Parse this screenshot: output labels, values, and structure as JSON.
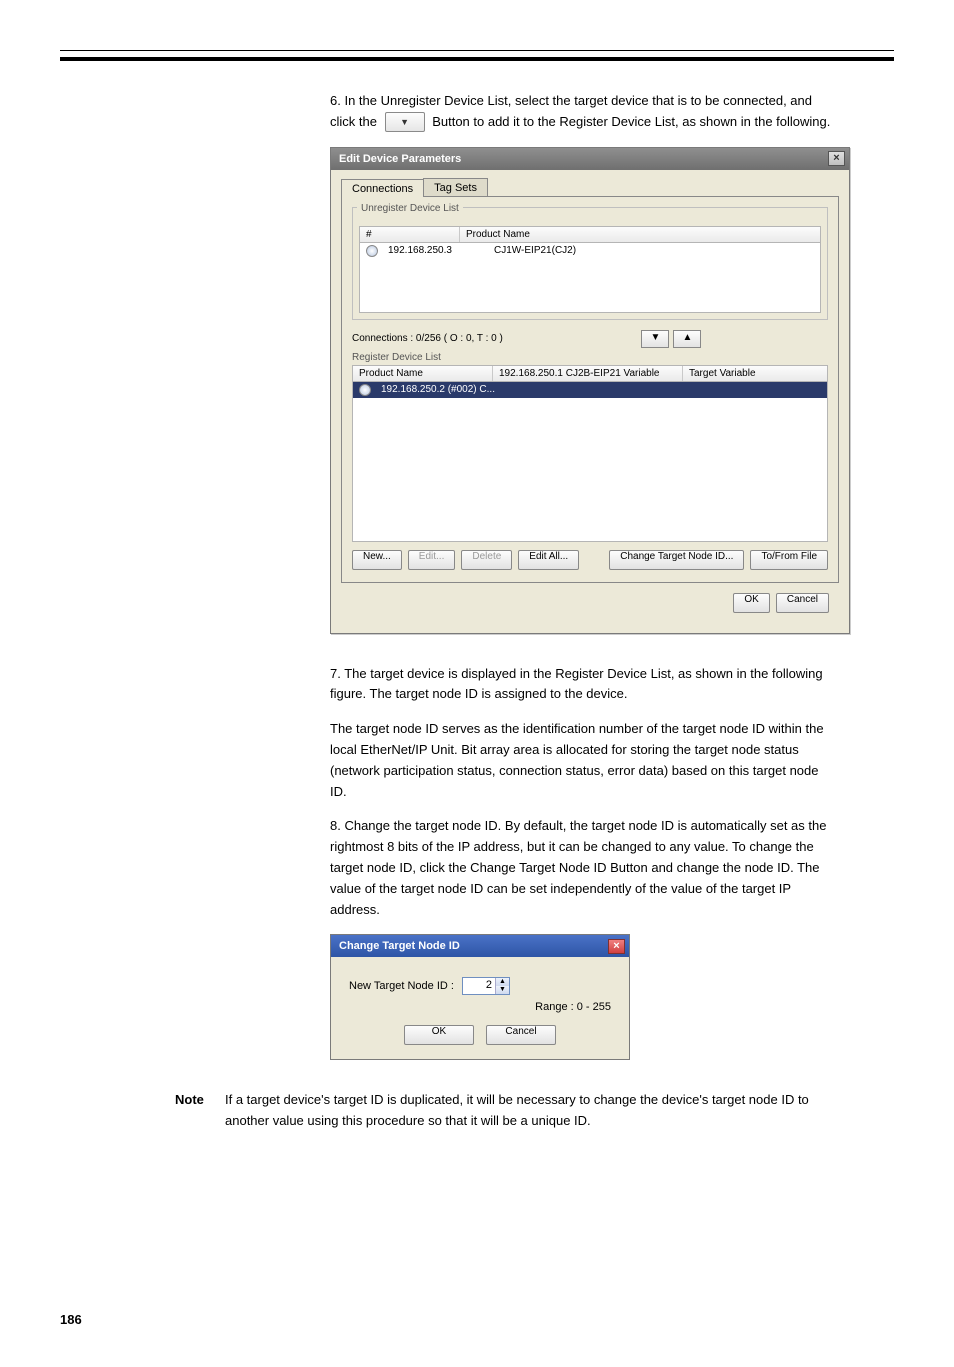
{
  "steps": {
    "s6": "6. In the Unregister Device List, select the target device that is to be connected, and click the  Button to add it to the Register Device List, as shown in the following.",
    "s7": "7. The target device is displayed in the Register Device List, as shown in the following figure. The target node ID is assigned to the device.",
    "s7b": "The target node ID serves as the identification number of the target node ID within the local EtherNet/IP Unit. Bit array area is allocated for storing the target node status (network participation status, connection status, error data) based on this target node ID.",
    "s8": "8. Change the target node ID. By default, the target node ID is automatically set as the rightmost 8 bits of the IP address, but it can be changed to any value. To change the target node ID, click the Change Target Node ID Button and change the node ID. The value of the target node ID can be set independently of the value of the target IP address."
  },
  "note": {
    "label": "Note",
    "text": "If a target device's target ID is duplicated, it will be necessary to change the device's target node ID to another value using this procedure so that it will be a unique ID."
  },
  "dlg1": {
    "title": "Edit Device Parameters",
    "tabs": {
      "connections": "Connections",
      "tagsets": "Tag Sets"
    },
    "unreg_group": "Unregister Device List",
    "cols_unreg": {
      "hash": "#",
      "product": "Product Name"
    },
    "unreg_row": {
      "ip": "192.168.250.3",
      "product": "CJ1W-EIP21(CJ2)"
    },
    "conn_text": "Connections :  0/256 ( O : 0, T : 0 )",
    "reg_group": "Register Device List",
    "cols_reg": {
      "product": "Product Name",
      "var": "192.168.250.1 CJ2B-EIP21 Variable",
      "target": "Target Variable"
    },
    "reg_row": {
      "text": "192.168.250.2 (#002) C..."
    },
    "buttons": {
      "new": "New...",
      "edit": "Edit...",
      "delete": "Delete",
      "editall": "Edit All...",
      "changetgt": "Change Target Node ID...",
      "tofrom": "To/From File",
      "ok": "OK",
      "cancel": "Cancel"
    }
  },
  "dlg2": {
    "title": "Change Target Node ID",
    "label": "New Target Node ID :",
    "value": "2",
    "range": "Range : 0 - 255",
    "ok": "OK",
    "cancel": "Cancel"
  },
  "footer": "186"
}
